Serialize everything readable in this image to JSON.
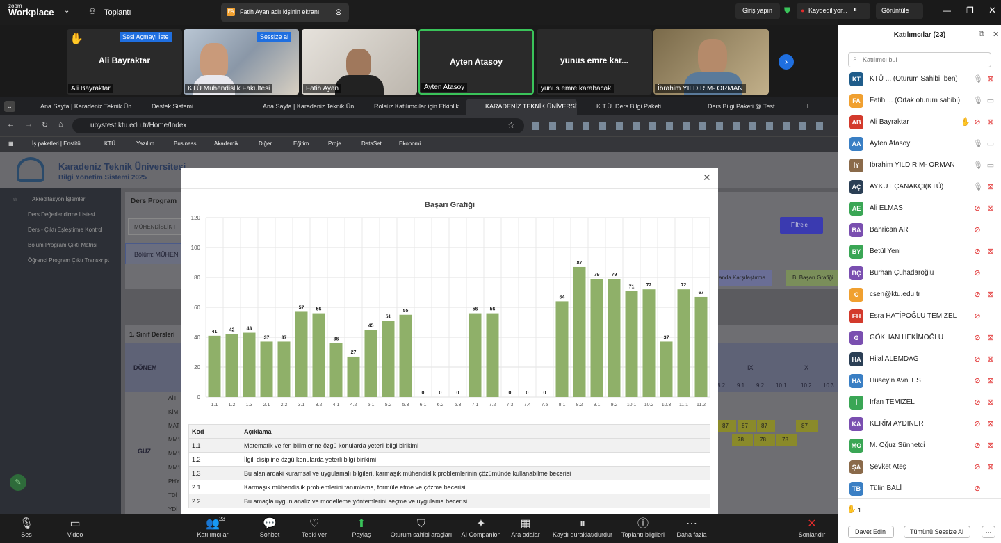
{
  "app": {
    "brand_top": "zoom",
    "brand_bottom": "Workplace",
    "meeting_label": "Toplantı",
    "share_banner": "Fatih Ayan adlı kişinin ekranı",
    "share_initials": "FA",
    "signin": "Giriş yapın",
    "recording": "Kaydediliyor...",
    "view": "Görüntüle"
  },
  "gallery": [
    {
      "name": "Ali Bayraktar",
      "label": "Ali Bayraktar",
      "overlay": "Sesi Açmayı İste"
    },
    {
      "name": "",
      "label": "KTÜ Mühendislik Fakültesi",
      "overlay": "Sessize al"
    },
    {
      "name": "",
      "label": "Fatih Ayan",
      "overlay": ""
    },
    {
      "name": "Ayten Atasoy",
      "label": "Ayten Atasoy",
      "overlay": ""
    },
    {
      "name": "yunus emre kar...",
      "label": "yunus emre karabacak",
      "overlay": ""
    },
    {
      "name": "",
      "label": "İbrahim YILDIRIM- ORMAN",
      "overlay": ""
    }
  ],
  "browser": {
    "tabs": [
      "Ana Sayfa | Karadeniz Teknik Ün...",
      "Destek Sistemi",
      "Ana Sayfa | Karadeniz Teknik Ün...",
      "Rolsüz Katılımcılar için Etkinlik...",
      "KARADENİZ TEKNİK ÜNİVERSİTESİ",
      "K.T.Ü. Ders Bilgi Paketi",
      "Ders Bilgi Paketi @ Test"
    ],
    "url": "ubystest.ktu.edu.tr/Home/Index",
    "bookmarks": [
      "İş paketleri | Enstitü...",
      "KTÜ",
      "Yazılım",
      "Business",
      "Akademik",
      "Diğer",
      "Eğitim",
      "Proje",
      "DataSet",
      "Ekonomi"
    ]
  },
  "site": {
    "uni_title": "Karadeniz Teknik Üniversitesi",
    "uni_subtitle": "Bilgi Yönetim Sistemi 2025",
    "menu": [
      "Akreditasyon İşlemleri",
      "Ders Değerlendirme Listesi",
      "Ders - Çıktı Eşleştirme Kontrol",
      "Bölüm Program Çıktı Matrisi",
      "Öğrenci Program Çıktı Transkript"
    ],
    "panel_title": "Ders Program",
    "field": "MÜHENDİSLİK F",
    "bolum": "Bölüm: MÜHEN",
    "filter_btn": "Filtrele",
    "btn_compare": "anda Karşılaştırma",
    "btn_graph": "B. Başarı Grafiği",
    "section": "1. Sınıf Dersleri",
    "donem": "DÖNEM",
    "guz": "GÜZ",
    "col_ix": "IX",
    "col_x": "X",
    "subcols": [
      "8.2",
      "9.1",
      "9.2",
      "10.1",
      "10.2",
      "10.3"
    ],
    "course_codes": [
      "AİT",
      "KİM",
      "MAT",
      "MM1",
      "MM1",
      "MM1",
      "PHY",
      "TDİ",
      "YDİ"
    ],
    "row87": [
      "87",
      "87",
      "87",
      "",
      "87"
    ],
    "row78": [
      "78",
      "78",
      "78"
    ]
  },
  "chart_data": {
    "type": "bar",
    "title": "Başarı Grafiği",
    "categories": [
      "1.1",
      "1.2",
      "1.3",
      "2.1",
      "2.2",
      "3.1",
      "3.2",
      "4.1",
      "4.2",
      "5.1",
      "5.2",
      "5.3",
      "6.1",
      "6.2",
      "6.3",
      "7.1",
      "7.2",
      "7.3",
      "7.4",
      "7.5",
      "8.1",
      "8.2",
      "9.1",
      "9.2",
      "10.1",
      "10.2",
      "10.3",
      "11.1",
      "11.2"
    ],
    "values": [
      41,
      42,
      43,
      37,
      37,
      57,
      56,
      36,
      27,
      45,
      51,
      55,
      0,
      0,
      0,
      56,
      56,
      0,
      0,
      0,
      64,
      87,
      79,
      79,
      71,
      72,
      37,
      72,
      67
    ],
    "ylim": [
      0,
      120
    ],
    "yticks": [
      0,
      20,
      40,
      60,
      80,
      100,
      120
    ],
    "color": "#8fb069",
    "grid": true
  },
  "codes_table": {
    "headers": [
      "Kod",
      "Açıklama"
    ],
    "rows": [
      [
        "1.1",
        "Matematik ve fen bilimlerine özgü konularda yeterli bilgi birikimi"
      ],
      [
        "1.2",
        "İlgili disipline özgü konularda yeterli bilgi birikimi"
      ],
      [
        "1.3",
        "Bu alanlardaki kuramsal ve uygulamalı bilgileri, karmaşık mühendislik problemlerinin çözümünde kullanabilme becerisi"
      ],
      [
        "2.1",
        "Karmaşık mühendislik problemlerini tanımlama, formüle etme ve çözme becerisi"
      ],
      [
        "2.2",
        "Bu amaçla uygun analiz ve modelleme yöntemlerini seçme ve uygulama becerisi"
      ]
    ]
  },
  "participants": {
    "title": "Katılımcılar (23)",
    "search_placeholder": "Katılımcı bul",
    "raised_count": "1",
    "invite": "Davet Edin",
    "mute_all": "Tümünü Sessize Al",
    "list": [
      {
        "initials": "KT",
        "name": "KTÜ ... (Oturum Sahibi, ben)",
        "color": "#1f5c8a",
        "mic": "on",
        "vid": "off"
      },
      {
        "initials": "FA",
        "name": "Fatih ... (Ortak oturum sahibi)",
        "color": "#f0a030",
        "mic": "on",
        "vid": "on"
      },
      {
        "initials": "AB",
        "name": "Ali Bayraktar",
        "color": "#d33a2c",
        "mic": "muted",
        "vid": "off",
        "hand": true
      },
      {
        "initials": "AA",
        "name": "Ayten Atasoy",
        "color": "#3a7fc4",
        "mic": "on",
        "vid": "on"
      },
      {
        "initials": "İY",
        "name": "İbrahim YILDIRIM- ORMAN",
        "color": "#8a6a4a",
        "mic": "on",
        "vid": "on"
      },
      {
        "initials": "AÇ",
        "name": "AYKUT ÇANAKÇI(KTÜ)",
        "color": "#2b3f55",
        "mic": "on",
        "vid": "off"
      },
      {
        "initials": "AE",
        "name": "Ali ELMAS",
        "color": "#3aa655",
        "mic": "muted",
        "vid": "off"
      },
      {
        "initials": "BA",
        "name": "Bahrican AR",
        "color": "#7a4fb0",
        "mic": "muted",
        "vid": ""
      },
      {
        "initials": "BY",
        "name": "Betül Yeni",
        "color": "#3aa655",
        "mic": "muted",
        "vid": "off"
      },
      {
        "initials": "BÇ",
        "name": "Burhan Çuhadaroğlu",
        "color": "#7a4fb0",
        "mic": "muted",
        "vid": ""
      },
      {
        "initials": "C",
        "name": "csen@ktu.edu.tr",
        "color": "#f0a030",
        "mic": "muted",
        "vid": "off"
      },
      {
        "initials": "EH",
        "name": "Esra HATİPOĞLU TEMİZEL",
        "color": "#d33a2c",
        "mic": "muted",
        "vid": ""
      },
      {
        "initials": "G",
        "name": "GÖKHAN HEKİMOĞLU",
        "color": "#7a4fb0",
        "mic": "muted",
        "vid": "off"
      },
      {
        "initials": "HA",
        "name": "Hilal ALEMDAĞ",
        "color": "#2b3f55",
        "mic": "muted",
        "vid": "off"
      },
      {
        "initials": "HA",
        "name": "Hüseyin Avni ES",
        "color": "#3a7fc4",
        "mic": "muted",
        "vid": "off"
      },
      {
        "initials": "İ",
        "name": "İrfan TEMİZEL",
        "color": "#3aa655",
        "mic": "muted",
        "vid": "off"
      },
      {
        "initials": "KA",
        "name": "KERİM AYDINER",
        "color": "#7a4fb0",
        "mic": "muted",
        "vid": "off"
      },
      {
        "initials": "MO",
        "name": "M. Oğuz Sünnetci",
        "color": "#3aa655",
        "mic": "muted",
        "vid": "off"
      },
      {
        "initials": "ŞA",
        "name": "Şevket Ateş",
        "color": "#8a6a4a",
        "mic": "muted",
        "vid": "off"
      },
      {
        "initials": "TB",
        "name": "Tülin BALİ",
        "color": "#3a7fc4",
        "mic": "muted",
        "vid": ""
      }
    ]
  },
  "toolbar": [
    {
      "label": "Ses",
      "icon": "mic-icon",
      "glyph": "🎙"
    },
    {
      "label": "Video",
      "icon": "video-icon",
      "glyph": "▭"
    },
    {
      "label": "Katılımcılar",
      "icon": "participants-icon",
      "glyph": "👥",
      "count": "23"
    },
    {
      "label": "Sohbet",
      "icon": "chat-icon",
      "glyph": "💬"
    },
    {
      "label": "Tepki ver",
      "icon": "heart-icon",
      "glyph": "♡"
    },
    {
      "label": "Paylaş",
      "icon": "share-icon",
      "glyph": "⬆"
    },
    {
      "label": "Oturum sahibi araçları",
      "icon": "shield-icon",
      "glyph": "⛉"
    },
    {
      "label": "AI Companion",
      "icon": "sparkle-icon",
      "glyph": "✦"
    },
    {
      "label": "Ara odalar",
      "icon": "grid-icon",
      "glyph": "▦"
    },
    {
      "label": "Kaydı duraklat/durdur",
      "icon": "pause-icon",
      "glyph": "⏸"
    },
    {
      "label": "Toplantı bilgileri",
      "icon": "info-icon",
      "glyph": "ⓘ"
    },
    {
      "label": "Daha fazla",
      "icon": "more-icon",
      "glyph": "⋯"
    },
    {
      "label": "Sonlandır",
      "icon": "end-icon",
      "glyph": "✕"
    }
  ]
}
